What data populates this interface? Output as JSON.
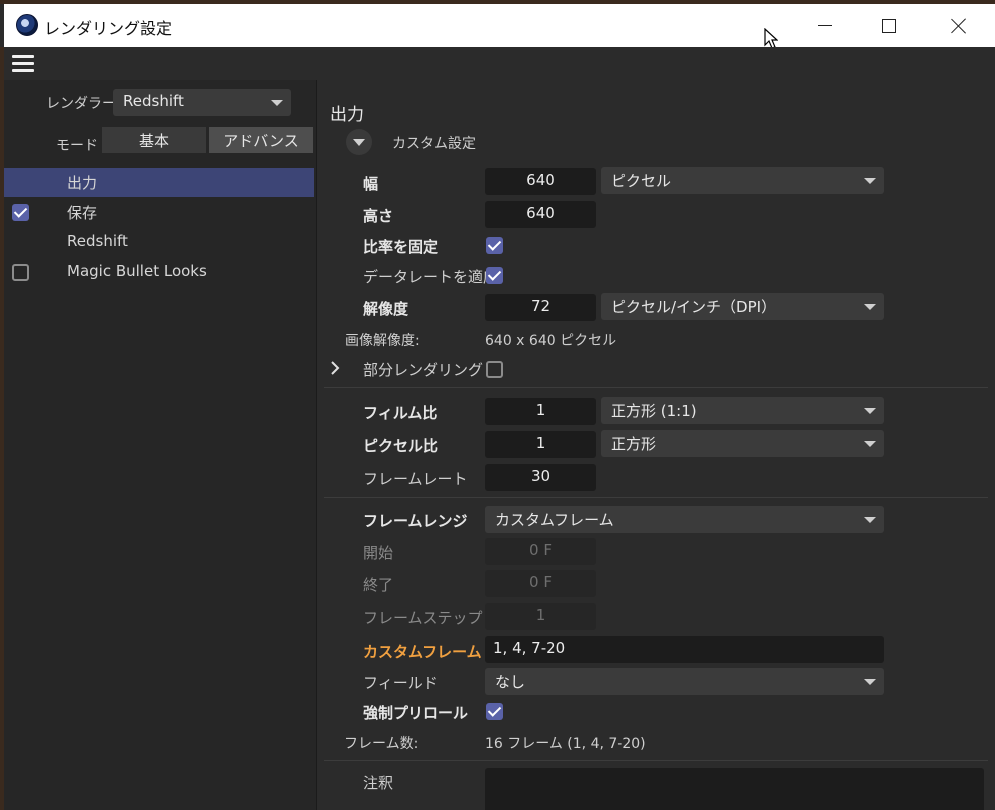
{
  "window": {
    "title": "レンダリング設定"
  },
  "sidebar": {
    "renderer_label": "レンダラー",
    "renderer_value": "Redshift",
    "mode_label": "モード",
    "mode_basic": "基本",
    "mode_advanced": "アドバンス",
    "items": [
      {
        "label": "出力",
        "checkbox": "none",
        "selected": true
      },
      {
        "label": "保存",
        "checkbox": "checked",
        "selected": false
      },
      {
        "label": "Redshift",
        "checkbox": "none",
        "selected": false
      },
      {
        "label": "Magic Bullet Looks",
        "checkbox": "unchecked",
        "selected": false
      }
    ]
  },
  "main": {
    "section_title": "出力",
    "preset": "カスタム設定",
    "width_label": "幅",
    "width_value": "640",
    "width_unit": "ピクセル",
    "height_label": "高さ",
    "height_value": "640",
    "lock_ratio_label": "比率を固定",
    "lock_ratio": true,
    "apply_datarate_label": "データレートを適応",
    "apply_datarate": true,
    "resolution_label": "解像度",
    "resolution_value": "72",
    "resolution_unit": "ピクセル/インチ（DPI）",
    "image_resolution_label": "画像解像度:",
    "image_resolution_value": "640 x 640 ピクセル",
    "partial_render_label": "部分レンダリング",
    "partial_render": false,
    "film_ratio_label": "フィルム比",
    "film_ratio_value": "1",
    "film_ratio_preset": "正方形 (1:1)",
    "pixel_ratio_label": "ピクセル比",
    "pixel_ratio_value": "1",
    "pixel_ratio_preset": "正方形",
    "frame_rate_label": "フレームレート",
    "frame_rate_value": "30",
    "frame_range_label": "フレームレンジ",
    "frame_range_value": "カスタムフレーム",
    "start_label": "開始",
    "start_value": "0 F",
    "end_label": "終了",
    "end_value": "0 F",
    "frame_step_label": "フレームステップ",
    "frame_step_value": "1",
    "custom_frames_label": "カスタムフレーム",
    "custom_frames_value": "1, 4, 7-20",
    "field_label": "フィールド",
    "field_value": "なし",
    "force_preroll_label": "強制プリロール",
    "force_preroll": true,
    "frame_count_label": "フレーム数:",
    "frame_count_value": "16 フレーム (1, 4, 7-20)",
    "notes_label": "注釈"
  },
  "colors": {
    "accent_orange": "#f0a040",
    "selection": "#3d4576",
    "checkbox": "#5a62a8"
  }
}
